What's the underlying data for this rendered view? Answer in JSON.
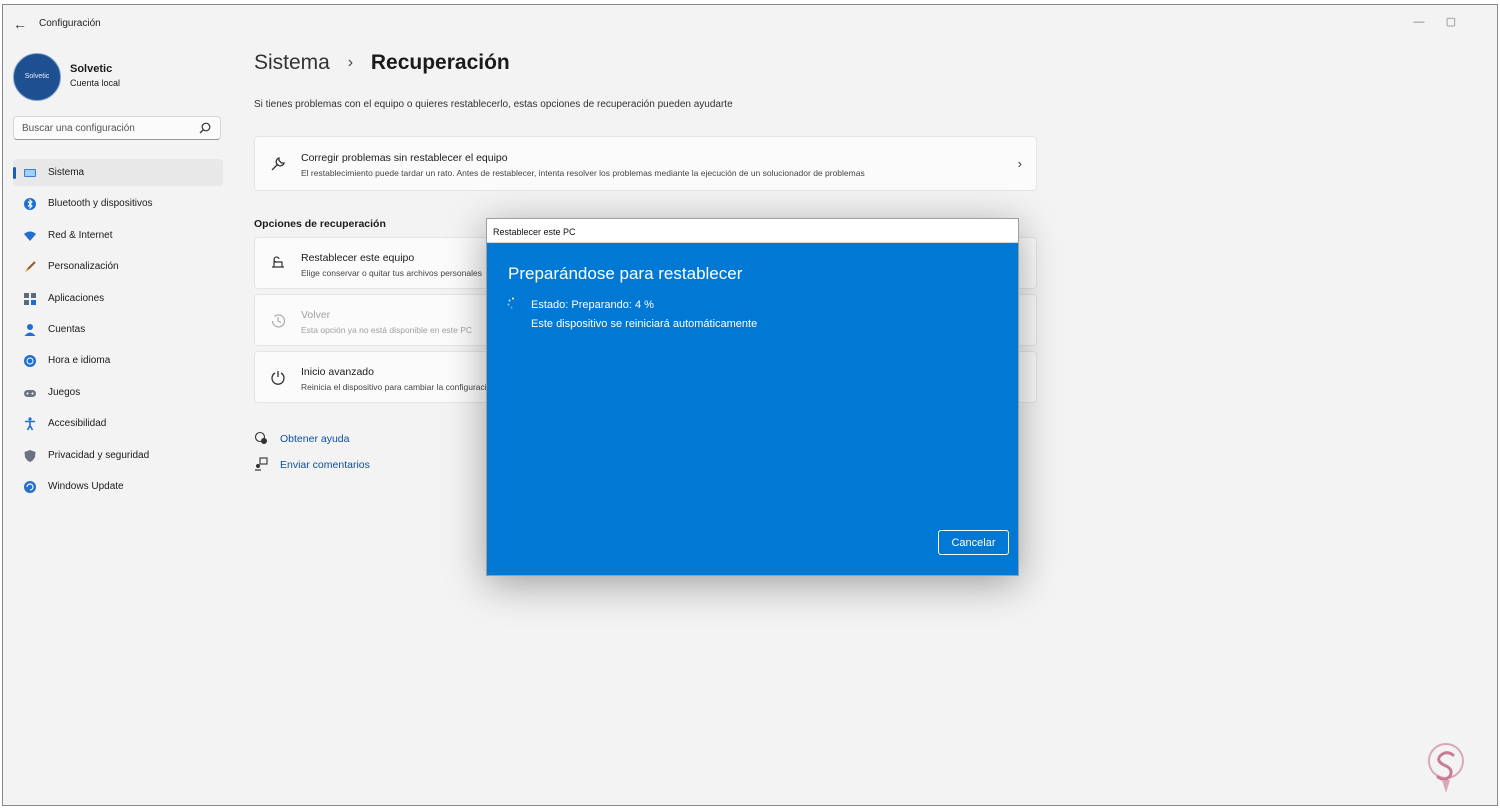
{
  "window": {
    "title": "Configuración",
    "back_glyph": "←",
    "minimize_glyph": "—",
    "maximize_glyph": "▢"
  },
  "profile": {
    "avatar_text": "Solvetic",
    "name": "Solvetic",
    "account_type": "Cuenta local"
  },
  "search": {
    "placeholder": "Buscar una configuración"
  },
  "nav": {
    "items": [
      {
        "label": "Sistema",
        "icon": "monitor-icon",
        "active": true
      },
      {
        "label": "Bluetooth y dispositivos",
        "icon": "bluetooth-icon"
      },
      {
        "label": "Red & Internet",
        "icon": "wifi-icon"
      },
      {
        "label": "Personalización",
        "icon": "brush-icon"
      },
      {
        "label": "Aplicaciones",
        "icon": "apps-icon"
      },
      {
        "label": "Cuentas",
        "icon": "person-icon"
      },
      {
        "label": "Hora e idioma",
        "icon": "globe-clock-icon"
      },
      {
        "label": "Juegos",
        "icon": "gamepad-icon"
      },
      {
        "label": "Accesibilidad",
        "icon": "accessibility-icon"
      },
      {
        "label": "Privacidad y seguridad",
        "icon": "shield-icon"
      },
      {
        "label": "Windows Update",
        "icon": "update-icon"
      }
    ]
  },
  "main": {
    "breadcrumb": {
      "parent": "Sistema",
      "separator": "›",
      "current": "Recuperación"
    },
    "description": "Si tienes problemas con el equipo o quieres restablecerlo, estas opciones de recuperación pueden ayudarte",
    "fix_card": {
      "title": "Corregir problemas sin restablecer el equipo",
      "subtitle": "El restablecimiento puede tardar un rato. Antes de restablecer, intenta resolver los problemas mediante la ejecución de un solucionador de problemas",
      "chevron": "›"
    },
    "section_title": "Opciones de recuperación",
    "options": [
      {
        "title": "Restablecer este equipo",
        "subtitle": "Elige conservar o quitar tus archivos personales",
        "icon": "reset-pc-icon"
      },
      {
        "title": "Volver",
        "subtitle": "Esta opción ya no está disponible en este PC",
        "icon": "history-icon",
        "disabled": true
      },
      {
        "title": "Inicio avanzado",
        "subtitle": "Reinicia el dispositivo para cambiar la configuración",
        "icon": "advanced-startup-icon"
      }
    ],
    "links": [
      {
        "label": "Obtener ayuda",
        "icon": "help-chat-icon"
      },
      {
        "label": "Enviar comentarios",
        "icon": "feedback-icon"
      }
    ]
  },
  "dialog": {
    "window_title": "Restablecer este PC",
    "heading": "Preparándose para restablecer",
    "status": "Estado: Preparando: 4 %",
    "note": "Este dispositivo se reiniciará automáticamente",
    "cancel_label": "Cancelar"
  },
  "colors": {
    "accent": "#0078d4",
    "link": "#0b4fa2",
    "window_bg": "#f3f3f3"
  }
}
